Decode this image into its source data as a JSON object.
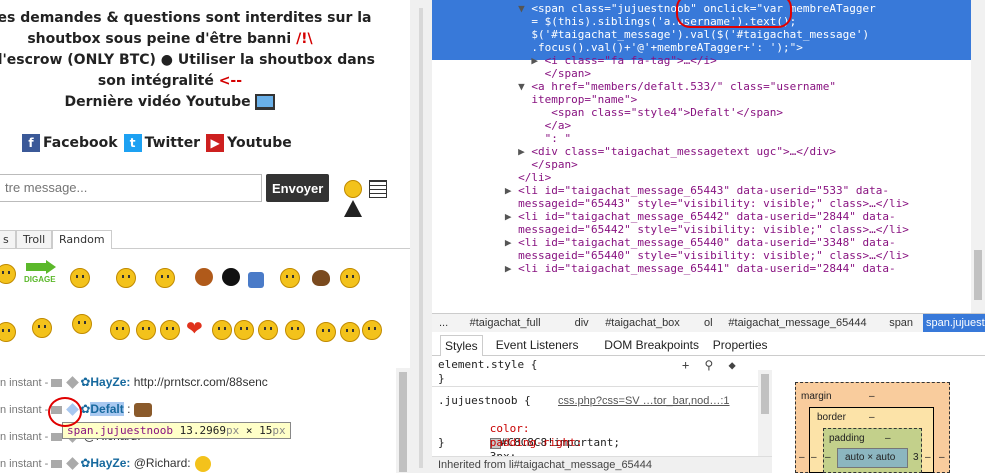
{
  "left_panel": {
    "notices": [
      {
        "text": "o: Les demandes & questions sont interdites sur la"
      },
      {
        "text": "shoutbox sous peine d'être banni",
        "suffix": "/!\\"
      },
      {
        "text": "ice d'escrow (ONLY BTC) ● Utiliser la shoutbox dans"
      },
      {
        "text": "son intégralité",
        "suffix": "<--"
      },
      {
        "text": "Dernière vidéo Youtube",
        "icon": "laptop-icon"
      }
    ],
    "social": [
      {
        "label": "Facebook",
        "icon": "facebook-icon",
        "color": "#3b5998",
        "glyph": "f"
      },
      {
        "label": "Twitter",
        "icon": "twitter-icon",
        "color": "#1da1f2",
        "glyph": "t"
      },
      {
        "label": "Youtube",
        "icon": "youtube-icon",
        "color": "#cd201f",
        "glyph": "▶"
      }
    ],
    "message_placeholder": "tre message...",
    "send_label": "Envoyer",
    "smiley_tabs": [
      {
        "label": "s",
        "active": false
      },
      {
        "label": "Troll",
        "active": false
      },
      {
        "label": "Random",
        "active": true
      }
    ],
    "smiley_buttons": [
      "DIGAGE"
    ],
    "shouts": [
      {
        "meta": "n instant -",
        "user": "HayZe:",
        "text": "http://prntscr.com/88senc"
      },
      {
        "meta": "n instant -",
        "user": "Defalt",
        "text": ":"
      },
      {
        "meta": "n instant -",
        "user": "",
        "text": "@Richard:"
      },
      {
        "meta": "n instant -",
        "user": "HayZe:",
        "text": "@Richard:"
      }
    ],
    "tooltip": {
      "selector": "span.jujuestnoob",
      "size": "13.2969",
      "unit": "px",
      "times": "×",
      "height": "15",
      "unit2": "px"
    }
  },
  "devtools": {
    "elements": [
      {
        "ind": 13,
        "tri": "▼",
        "html": "<span class=\"jujuestnoob\" onclick=\"var membreATagger"
      },
      {
        "ind": 13,
        "tri": "",
        "html": "= $(this).siblings('a.username').text();"
      },
      {
        "ind": 13,
        "tri": "",
        "html": "$('#taigachat_message').val($('#taigachat_message')"
      },
      {
        "ind": 13,
        "tri": "",
        "html": ".focus().val()+'@'+membreATagger+': ');\">"
      },
      {
        "ind": 15,
        "tri": "▶",
        "html": "<i class=\"fa fa-tag\">…</i>"
      },
      {
        "ind": 15,
        "tri": "",
        "html": "</span>"
      },
      {
        "ind": 13,
        "tri": "▼",
        "html": "<a href=\"members/defalt.533/\" class=\"username\""
      },
      {
        "ind": 13,
        "tri": "",
        "html": "itemprop=\"name\">"
      },
      {
        "ind": 16,
        "tri": "",
        "html": "<span class=\"style4\">Defalt'</span>"
      },
      {
        "ind": 15,
        "tri": "",
        "html": "</a>"
      },
      {
        "ind": 15,
        "tri": "",
        "html": "\": \""
      },
      {
        "ind": 13,
        "tri": "▶",
        "html": "<div class=\"taigachat_messagetext ugc\">…</div>"
      },
      {
        "ind": 13,
        "tri": "",
        "html": "</span>"
      },
      {
        "ind": 11,
        "tri": "",
        "html": "</li>"
      },
      {
        "ind": 11,
        "tri": "▶",
        "html": "<li id=\"taigachat_message_65443\" data-userid=\"533\" data-"
      },
      {
        "ind": 11,
        "tri": "",
        "html": "messageid=\"65443\" style=\"visibility: visible;\" class>…</li>"
      },
      {
        "ind": 11,
        "tri": "▶",
        "html": "<li id=\"taigachat_message_65442\" data-userid=\"2844\" data-"
      },
      {
        "ind": 11,
        "tri": "",
        "html": "messageid=\"65442\" style=\"visibility: visible;\" class>…</li>"
      },
      {
        "ind": 11,
        "tri": "▶",
        "html": "<li id=\"taigachat_message_65440\" data-userid=\"3348\" data-"
      },
      {
        "ind": 11,
        "tri": "",
        "html": "messageid=\"65440\" style=\"visibility: visible;\" class>…</li>"
      },
      {
        "ind": 11,
        "tri": "▶",
        "html": "<li id=\"taigachat_message_65441\" data-userid=\"2844\" data-"
      }
    ],
    "breadcrumbs": [
      "...",
      "#taigachat_full",
      "div",
      "#taigachat_box",
      "ol",
      "#taigachat_message_65444",
      "span",
      "span.jujuestnoob"
    ],
    "panel_tabs": [
      "Styles",
      "Event Listeners",
      "DOM Breakpoints",
      "Properties"
    ],
    "styles": {
      "element_style": "element.style {",
      "element_close": "}",
      "rule_selector": ".jujuestnoob {",
      "rule_source": "css.php?css=SV …tor_bar,nod…:1",
      "prop1_name": "color:",
      "prop1_value": "#C8C8C8!important;",
      "prop2_name": "padding-right:",
      "prop2_value": "3px;",
      "rule_close": "}",
      "inherited": "Inherited from li#taigachat_message_65444",
      "swatch": "#C8C8C8"
    },
    "box_model": {
      "margin": "margin",
      "border": "border",
      "padding": "padding",
      "content": "auto × auto",
      "dash": "–",
      "right_val": "3"
    }
  }
}
